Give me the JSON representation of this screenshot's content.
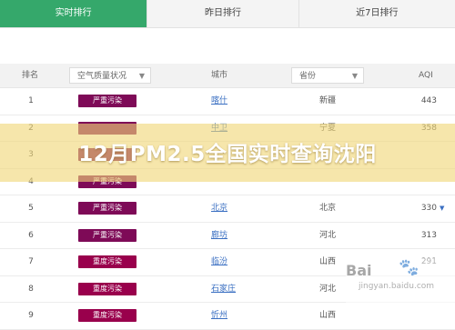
{
  "tabs": [
    {
      "label": "实时排行",
      "active": true
    },
    {
      "label": "昨日排行",
      "active": false
    },
    {
      "label": "近7日排行",
      "active": false
    }
  ],
  "table": {
    "headers": {
      "rank": "排名",
      "quality": "空气质量状况",
      "city": "城市",
      "province": "省份",
      "aqi": "AQI"
    },
    "rows": [
      {
        "rank": "1",
        "level": "严重污染",
        "city": "喀什",
        "province": "新疆",
        "aqi": "443",
        "color": "#7e0a57"
      },
      {
        "rank": "2",
        "level": "",
        "city": "中卫",
        "province": "宁夏",
        "aqi": "358",
        "color": "#7e0a57"
      },
      {
        "rank": "3",
        "level": "",
        "city": "",
        "province": "",
        "aqi": "",
        "color": "#7e0a57"
      },
      {
        "rank": "4",
        "level": "严重污染",
        "city": "",
        "province": "",
        "aqi": "",
        "color": "#7e0a57"
      },
      {
        "rank": "5",
        "level": "严重污染",
        "city": "北京",
        "province": "北京",
        "aqi": "330",
        "color": "#7e0a57",
        "arrow": "▼"
      },
      {
        "rank": "6",
        "level": "严重污染",
        "city": "廊坊",
        "province": "河北",
        "aqi": "313",
        "color": "#7e0a57"
      },
      {
        "rank": "7",
        "level": "重度污染",
        "city": "临汾",
        "province": "山西",
        "aqi": "291",
        "color": "#99004c"
      },
      {
        "rank": "8",
        "level": "重度污染",
        "city": "石家庄",
        "province": "河北",
        "aqi": "",
        "color": "#99004c"
      },
      {
        "rank": "9",
        "level": "重度污染",
        "city": "忻州",
        "province": "山西",
        "aqi": "",
        "color": "#99004c"
      }
    ]
  },
  "overlay": {
    "title": "12月PM2.5全国实时查询沈阳"
  },
  "watermark": {
    "text": "Bai",
    "paw": "🐾",
    "sub": "jingyan.baidu.com"
  },
  "colors": {
    "active_tab": "#35a86b",
    "severe": "#7e0a57",
    "heavy": "#99004c",
    "link": "#3a6fc2"
  }
}
